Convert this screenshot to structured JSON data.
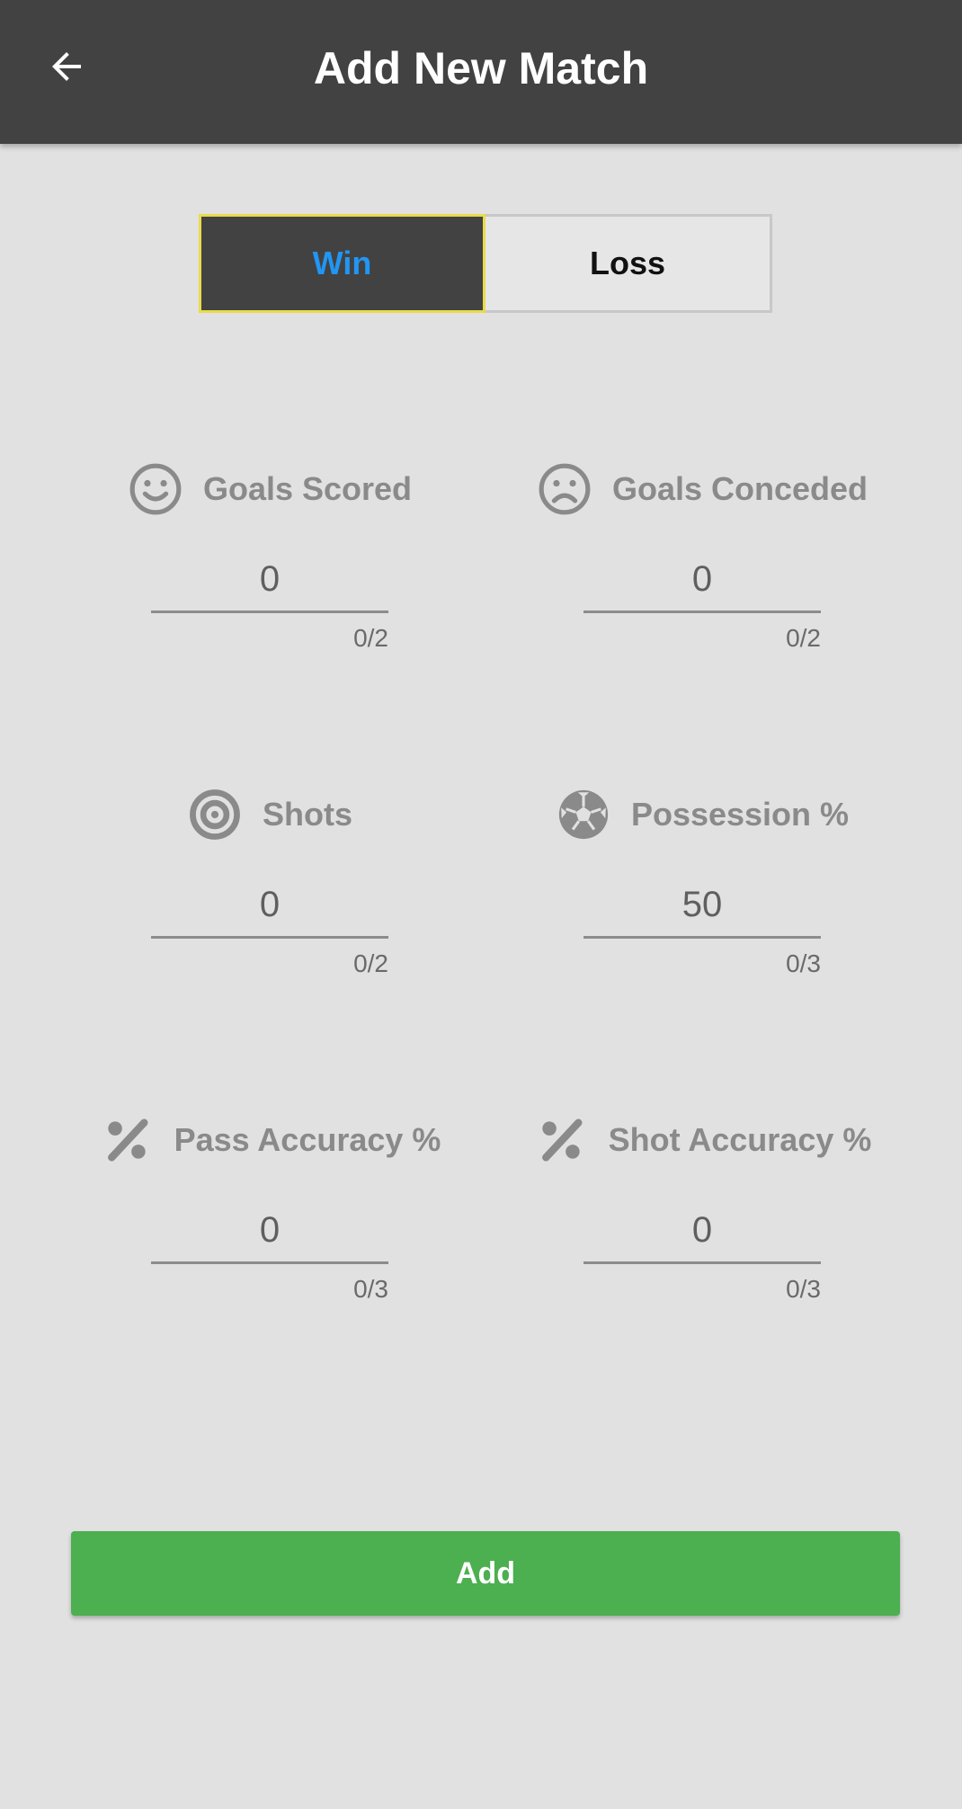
{
  "app_bar": {
    "title": "Add New Match",
    "back_icon": "arrow-back-icon",
    "background": "#424242"
  },
  "result_toggle": {
    "options": [
      "Win",
      "Loss"
    ],
    "selected": "Win",
    "selected_text_color": "#2196f3",
    "selected_border_color": "#e8dc4a"
  },
  "fields": [
    {
      "label": "Goals Scored",
      "icon": "smile-icon",
      "value": "0",
      "counter": "0/2"
    },
    {
      "label": "Goals Conceded",
      "icon": "sad-face-icon",
      "value": "0",
      "counter": "0/2"
    },
    {
      "label": "Shots",
      "icon": "target-icon",
      "value": "0",
      "counter": "0/2"
    },
    {
      "label": "Possession %",
      "icon": "soccer-ball-icon",
      "value": "50",
      "counter": "0/3"
    },
    {
      "label": "Pass Accuracy %",
      "icon": "percent-icon",
      "value": "0",
      "counter": "0/3"
    },
    {
      "label": "Shot Accuracy %",
      "icon": "percent-icon",
      "value": "0",
      "counter": "0/3"
    }
  ],
  "add_button": {
    "label": "Add",
    "color": "#4caf50"
  }
}
